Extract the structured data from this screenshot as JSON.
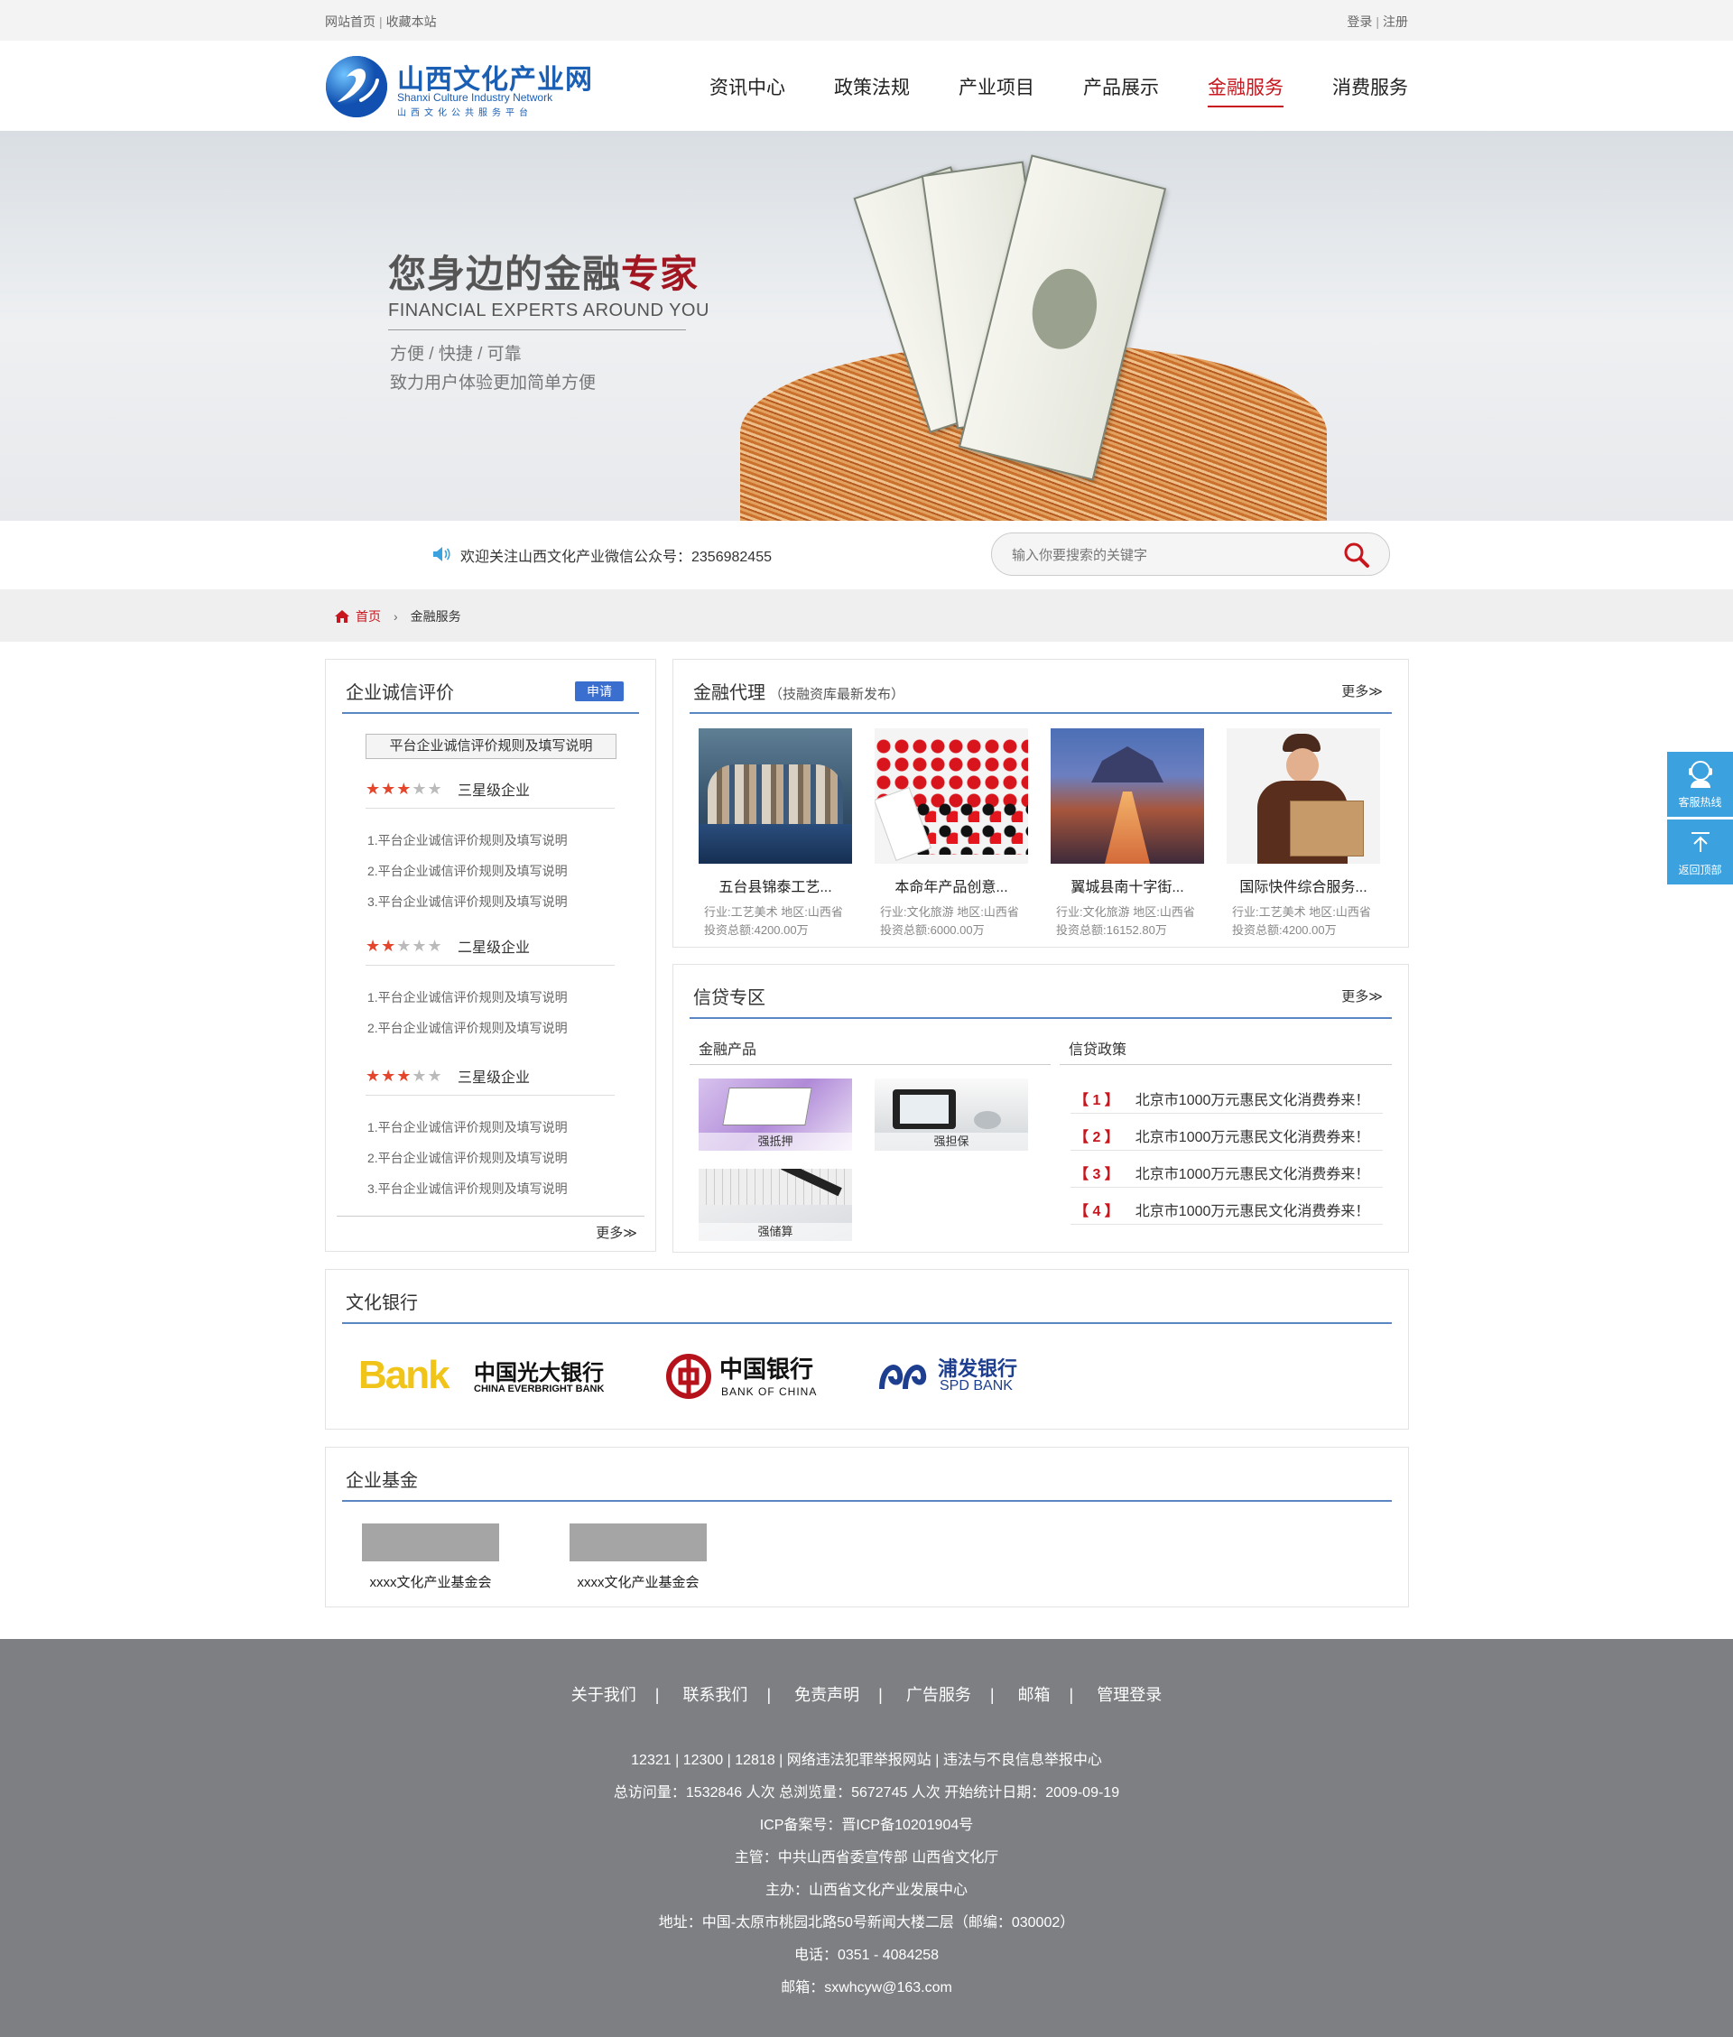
{
  "topbar": {
    "home": "网站首页",
    "fav": "收藏本站",
    "login": "登录",
    "register": "注册"
  },
  "logo": {
    "cn": "山西文化产业网",
    "en": "Shanxi Culture Industry Network",
    "sub": "山西文化公共服务平台"
  },
  "nav": [
    {
      "label": "资讯中心"
    },
    {
      "label": "政策法规"
    },
    {
      "label": "产业项目"
    },
    {
      "label": "产品展示"
    },
    {
      "label": "金融服务",
      "active": true
    },
    {
      "label": "消费服务"
    }
  ],
  "banner": {
    "title_a": "您身边的金融",
    "title_b": "专家",
    "en": "FINANCIAL EXPERTS AROUND YOU",
    "s1": "方便 / 快捷 / 可靠",
    "s2": "致力用户体验更加简单方便"
  },
  "notice": {
    "text": "欢迎关注山西文化产业微信公众号：2356982455",
    "search_placeholder": "输入你要搜索的关键字"
  },
  "breadcrumb": {
    "home": "首页",
    "arrow": "›",
    "current": "金融服务"
  },
  "credit_eval": {
    "title": "企业诚信评价",
    "apply": "申请",
    "rules_button": "平台企业诚信评价规则及填写说明",
    "groups": [
      {
        "label": "三星级企业",
        "stars": 3,
        "items": [
          "1.平台企业诚信评价规则及填写说明",
          "2.平台企业诚信评价规则及填写说明",
          "3.平台企业诚信评价规则及填写说明"
        ]
      },
      {
        "label": "二星级企业",
        "stars": 2,
        "items": [
          "1.平台企业诚信评价规则及填写说明",
          "2.平台企业诚信评价规则及填写说明"
        ]
      },
      {
        "label": "三星级企业",
        "stars": 3,
        "items": [
          "1.平台企业诚信评价规则及填写说明",
          "2.平台企业诚信评价规则及填写说明",
          "3.平台企业诚信评价规则及填写说明"
        ]
      }
    ],
    "more": "更多≫"
  },
  "finance_agent": {
    "title": "金融代理",
    "subtitle": "（技融资库最新发布）",
    "more": "更多≫",
    "products": [
      {
        "name": "五台县锦泰工艺...",
        "meta1": "行业:工艺美术 地区:山西省",
        "meta2": "投资总额:4200.00万"
      },
      {
        "name": "本命年产品创意...",
        "meta1": "行业:文化旅游 地区:山西省",
        "meta2": "投资总额:6000.00万"
      },
      {
        "name": "翼城县南十字街...",
        "meta1": "行业:文化旅游 地区:山西省",
        "meta2": "投资总额:16152.80万"
      },
      {
        "name": "国际快件综合服务...",
        "meta1": "行业:工艺美术 地区:山西省",
        "meta2": "投资总额:4200.00万"
      }
    ]
  },
  "credit_zone": {
    "title": "信贷专区",
    "more": "更多≫",
    "products_title": "金融产品",
    "policy_title": "信贷政策",
    "tiles": [
      "强抵押",
      "强担保",
      "强储算"
    ],
    "policies": [
      {
        "n": "【 1 】",
        "text": "北京市1000万元惠民文化消费券来！"
      },
      {
        "n": "【 2 】",
        "text": "北京市1000万元惠民文化消费券来！"
      },
      {
        "n": "【 3 】",
        "text": "北京市1000万元惠民文化消费券来！"
      },
      {
        "n": "【 4 】",
        "text": "北京市1000万元惠民文化消费券来！"
      }
    ]
  },
  "culture_bank": {
    "title": "文化银行",
    "banks": [
      {
        "logo_word": "Bank",
        "cn": "中国光大银行",
        "en": "CHINA EVERBRIGHT BANK"
      },
      {
        "cn": "中国银行",
        "en": "BANK OF CHINA"
      },
      {
        "cn": "浦发银行",
        "en": "SPD BANK"
      }
    ]
  },
  "enterprise_fund": {
    "title": "企业基金",
    "funds": [
      "xxxx文化产业基金会",
      "xxxx文化产业基金会"
    ]
  },
  "float": {
    "hotline": "客服热线",
    "top": "返回顶部"
  },
  "footer": {
    "links": [
      "关于我们",
      "联系我们",
      "免责声明",
      "广告服务",
      "邮箱",
      "管理登录"
    ],
    "sep": "|",
    "lines": [
      "12321 | 12300 | 12818 | 网络违法犯罪举报网站 | 违法与不良信息举报中心",
      "总访问量：1532846 人次  总浏览量：5672745 人次  开始统计日期：2009-09-19",
      "ICP备案号：晋ICP备10201904号",
      "主管：中共山西省委宣传部 山西省文化厅",
      "主办：山西省文化产业发展中心",
      "地址：中国-太原市桃园北路50号新闻大楼二层（邮编：030002）",
      "电话：0351 - 4084258",
      "邮箱：sxwhcyw@163.com"
    ]
  },
  "colors": {
    "accent_red": "#c7161d",
    "accent_blue": "#5a86c4",
    "float_blue": "#3ba1df",
    "footer_gray": "#7d7f82"
  }
}
